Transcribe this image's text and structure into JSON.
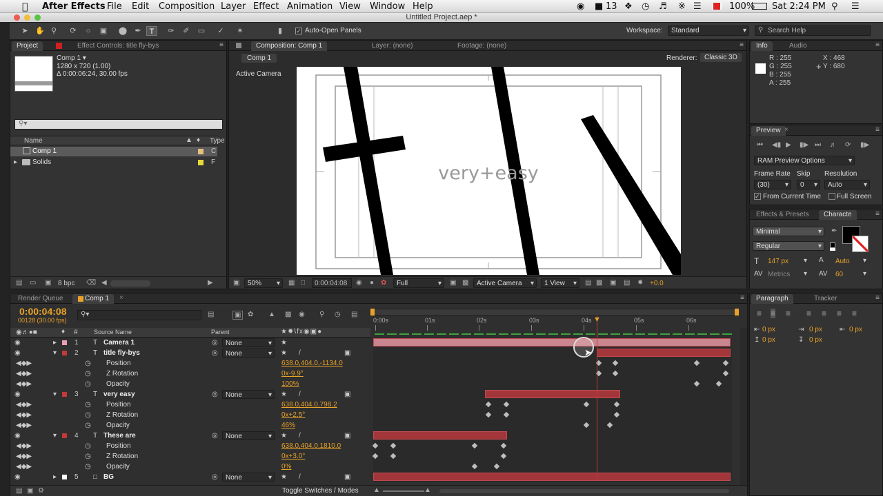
{
  "menubar": {
    "app": "After Effects",
    "items": [
      "File",
      "Edit",
      "Composition",
      "Layer",
      "Effect",
      "Animation",
      "View",
      "Window",
      "Help"
    ],
    "status": {
      "notif": "13",
      "battery": "100%",
      "clock": "Sat 2:24 PM"
    }
  },
  "window": {
    "title": "Untitled Project.aep *"
  },
  "toolbar": {
    "auto_open": "Auto-Open Panels",
    "workspace_label": "Workspace:",
    "workspace_value": "Standard",
    "search_placeholder": "Search Help"
  },
  "project": {
    "tab": "Project",
    "effect_controls": "Effect Controls: title fly-bys",
    "comp_name": "Comp 1 ▾",
    "comp_size": "1280 x 720 (1.00)",
    "comp_dur": "Δ 0:00:06:24, 30.00 fps",
    "col_name": "Name",
    "col_type": "Type",
    "items": [
      {
        "name": "Comp 1",
        "type": "C"
      },
      {
        "name": "Solids",
        "type": "F"
      }
    ],
    "bpc": "8 bpc"
  },
  "composition": {
    "tab": "Composition: Comp 1",
    "layer_tab": "Layer: (none)",
    "footage_tab": "Footage: (none)",
    "subtab": "Comp 1",
    "renderer_label": "Renderer:",
    "renderer_value": "Classic 3D",
    "camera_label": "Active Camera",
    "canvas_text": "very+easy",
    "zoom": "50%",
    "timecode": "0:00:04:08",
    "resolution": "Full",
    "camera_drop": "Active Camera",
    "view_drop": "1 View",
    "exposure": "+0.0"
  },
  "info": {
    "tab": "Info",
    "audio_tab": "Audio",
    "r": "R : 255",
    "g": "G : 255",
    "b": "B : 255",
    "a": "A : 255",
    "x": "X : 468",
    "y": "Y : 680"
  },
  "preview": {
    "tab": "Preview",
    "ram": "RAM Preview Options",
    "frame_rate_label": "Frame Rate",
    "skip_label": "Skip",
    "resolution_label": "Resolution",
    "frame_rate": "(30)",
    "skip": "0",
    "resolution": "Auto",
    "from_current": "From Current Time",
    "full_screen": "Full Screen"
  },
  "effects": {
    "tab": "Effects & Presets",
    "char_tab": "Characte",
    "font": "Minimal",
    "style": "Regular",
    "size": "147 px",
    "leading": "Auto",
    "metrics": "Metrics",
    "tracking": "60"
  },
  "paragraph": {
    "tab": "Paragraph",
    "tracker_tab": "Tracker",
    "v1": "0 px",
    "v2": "0 px",
    "v3": "0 px",
    "v4": "0 px",
    "v5": "0 px"
  },
  "timeline": {
    "render_queue": "Render Queue",
    "comp_tab": "Comp 1",
    "timecode": "0:00:04:08",
    "frames": "00128 (30.00 fps)",
    "col_source": "Source Name",
    "col_parent": "Parent",
    "toggle": "Toggle Switches / Modes",
    "ruler": [
      "0:00s",
      "01s",
      "02s",
      "03s",
      "04s",
      "05s",
      "06s"
    ],
    "layers": [
      {
        "num": "1",
        "name": "Camera 1",
        "color": "#e8a0b4",
        "parent": "None"
      },
      {
        "num": "2",
        "name": "title fly-bys",
        "color": "#c23a3a",
        "parent": "None",
        "props": [
          {
            "name": "Position",
            "value": "638.0,404.0,-1134.0"
          },
          {
            "name": "Z Rotation",
            "value": "0x-9.9°"
          },
          {
            "name": "Opacity",
            "value": "100%"
          }
        ]
      },
      {
        "num": "3",
        "name": "very easy",
        "color": "#c23a3a",
        "parent": "None",
        "props": [
          {
            "name": "Position",
            "value": "638.0,404.0,798.2"
          },
          {
            "name": "Z Rotation",
            "value": "0x+2.5°"
          },
          {
            "name": "Opacity",
            "value": "46%"
          }
        ]
      },
      {
        "num": "4",
        "name": "These are",
        "color": "#c23a3a",
        "parent": "None",
        "props": [
          {
            "name": "Position",
            "value": "638.0,404.0,1810.0"
          },
          {
            "name": "Z Rotation",
            "value": "0x+3.0°"
          },
          {
            "name": "Opacity",
            "value": "0%"
          }
        ]
      },
      {
        "num": "5",
        "name": "BG",
        "color": "#ffffff",
        "parent": "None"
      }
    ]
  }
}
